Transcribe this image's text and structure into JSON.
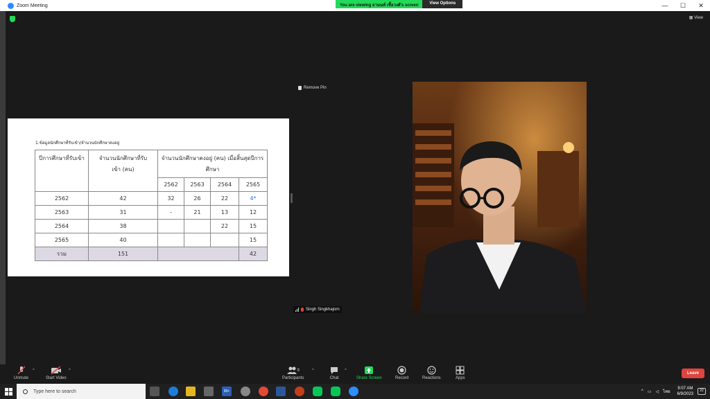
{
  "window": {
    "title": "Zoom Meeting",
    "controls": [
      "—",
      "☐",
      "✕"
    ]
  },
  "share_banner": {
    "viewing_text": "You are viewing ธานนท์ เชื้อวงศ์'s screen",
    "view_options_label": "View Options"
  },
  "stage": {
    "view_label": "View",
    "remove_pin_label": "Remove Pin",
    "participant_name": "Singh Singkhajorn"
  },
  "document": {
    "heading": "1.ข้อมูลนักศึกษาที่รับเข้า/จำนวนนักศึกษาคงอยู่",
    "table": {
      "col1_header": "ปีการศึกษาที่รับเข้า",
      "col2_header": "จำนวนนักศึกษาที่รับเข้า (คน)",
      "col3_header": "จำนวนนักศึกษาคงอยู่ (คน) เมื่อสิ้นสุดปีการศึกษา",
      "years": [
        "2562",
        "2563",
        "2564",
        "2565"
      ],
      "rows": [
        {
          "year": "2562",
          "admitted": "42",
          "y2562": "32",
          "y2563": "26",
          "y2564": "22",
          "y2565": "4*"
        },
        {
          "year": "2563",
          "admitted": "31",
          "y2562": "-",
          "y2563": "21",
          "y2564": "13",
          "y2565": "12"
        },
        {
          "year": "2564",
          "admitted": "38",
          "y2562": "",
          "y2563": "",
          "y2564": "22",
          "y2565": "15"
        },
        {
          "year": "2565",
          "admitted": "40",
          "y2562": "",
          "y2563": "",
          "y2564": "",
          "y2565": "15"
        }
      ],
      "total_label": "รวม",
      "total_admitted": "151",
      "total_2565": "42"
    }
  },
  "toolbar": {
    "unmute": "Unmute",
    "start_video": "Start Video",
    "participants": "Participants",
    "participants_count": "9",
    "chat": "Chat",
    "share_screen": "Share Screen",
    "record": "Record",
    "reactions": "Reactions",
    "apps": "Apps",
    "leave": "Leave"
  },
  "taskbar": {
    "search_placeholder": "Type here to search",
    "badge": "99+",
    "language": "ไทย",
    "time": "9:07 AM",
    "date": "6/9/2023",
    "notifications": "22"
  },
  "colors": {
    "zoom_green": "#23d959",
    "zoom_blue": "#2d8cff",
    "leave_red": "#e0443e",
    "table_total_bg": "#ddd9e4"
  }
}
